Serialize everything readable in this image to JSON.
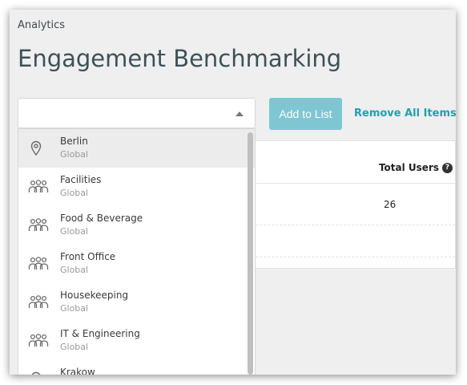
{
  "breadcrumb": "Analytics",
  "title": "Engagement Benchmarking",
  "actions": {
    "add_label": "Add to List",
    "remove_label": "Remove All Items"
  },
  "table": {
    "header_total": "Total Users",
    "help_glyph": "?",
    "rows": [
      {
        "total": "26"
      }
    ]
  },
  "dropdown": {
    "items": [
      {
        "name": "Berlin",
        "sub": "Global",
        "icon": "location-pin-icon",
        "highlighted": true
      },
      {
        "name": "Facilities",
        "sub": "Global",
        "icon": "group-icon"
      },
      {
        "name": "Food & Beverage",
        "sub": "Global",
        "icon": "group-icon"
      },
      {
        "name": "Front Office",
        "sub": "Global",
        "icon": "group-icon"
      },
      {
        "name": "Housekeeping",
        "sub": "Global",
        "icon": "group-icon"
      },
      {
        "name": "IT & Engineering",
        "sub": "Global",
        "icon": "group-icon"
      },
      {
        "name": "Krakow",
        "sub": "",
        "icon": "location-pin-icon"
      }
    ]
  },
  "colors": {
    "accent": "#1fa0b4",
    "button_disabled": "#7fc6d3",
    "title": "#3d5157"
  }
}
